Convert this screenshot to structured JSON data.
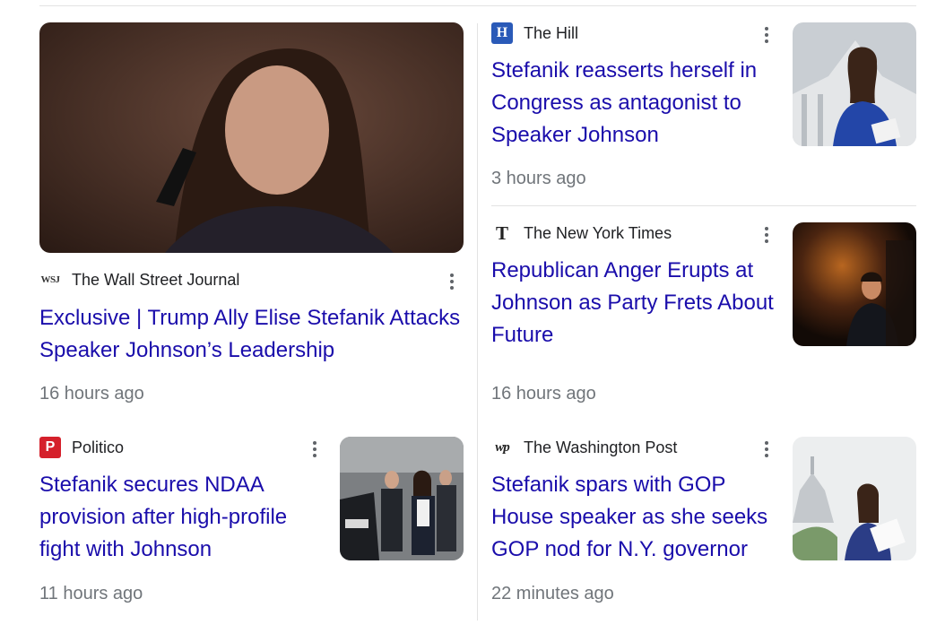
{
  "stories": [
    {
      "source": "The Wall Street Journal",
      "source_logo": "wsj-logo",
      "headline": "Exclusive | Trump Ally Elise Stefanik Attacks Speaker Johnson’s Leadership",
      "time": "16 hours ago"
    },
    {
      "source": "The Hill",
      "source_logo": "the-hill-logo",
      "headline": "Stefanik reasserts herself in Congress as antagonist to Speaker Johnson",
      "time": "3 hours ago"
    },
    {
      "source": "The New York Times",
      "source_logo": "nyt-logo",
      "headline": "Republican Anger Erupts at Johnson as Party Frets About Future",
      "time": "16 hours ago"
    },
    {
      "source": "Politico",
      "source_logo": "politico-logo",
      "headline": "Stefanik secures NDAA provision after high-profile fight with Johnson",
      "time": "11 hours ago"
    },
    {
      "source": "The Washington Post",
      "source_logo": "washington-post-logo",
      "headline": "Stefanik spars with GOP House speaker as she seeks GOP nod for N.Y. governor",
      "time": "22 minutes ago"
    }
  ],
  "logo_marks": {
    "wsj": "WSJ",
    "hill": "H",
    "nyt": "T",
    "politico": "P",
    "wapo": "wp"
  },
  "colors": {
    "headline_link": "#1a0dab",
    "meta_text": "#70757a",
    "source_text": "#202124",
    "hill_logo_bg": "#2a5ab8",
    "politico_logo_bg": "#d5202b"
  },
  "icons": {
    "more_menu": "three-dot-vertical-icon"
  }
}
